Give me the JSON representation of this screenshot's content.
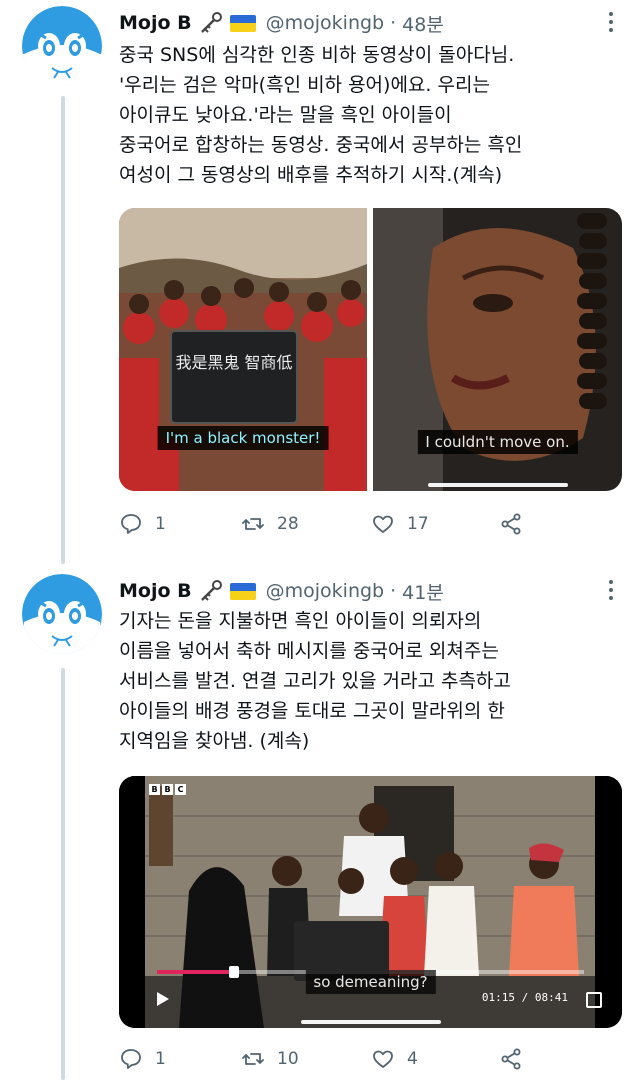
{
  "tweets": [
    {
      "name": "Mojo B",
      "handle": "@mojokingb",
      "separator": "·",
      "time": "48분",
      "lines": [
        "중국 SNS에 심각한 인종 비하 동영상이 돌아다님.",
        "'우리는 검은 악마(흑인 비하 용어)에요. 우리는",
        "아이큐도 낮아요.'라는 말을 흑인 아이들이",
        "중국어로 합창하는 동영상. 중국에서 공부하는 흑인",
        "여성이 그 동영상의 배후를 추적하기 시작.(계속)"
      ],
      "media": [
        {
          "sign_text": "我是黑鬼 智商低",
          "caption": "I'm a black monster!"
        },
        {
          "caption": "I couldn't move on."
        }
      ],
      "replies": "1",
      "retweets": "28",
      "likes": "17"
    },
    {
      "name": "Mojo B",
      "handle": "@mojokingb",
      "separator": "·",
      "time": "41분",
      "lines": [
        "기자는 돈을 지불하면 흑인 아이들이 의뢰자의",
        "이름을 넣어서 축하 메시지를 중국어로 외쳐주는",
        "서비스를 발견. 연결 고리가 있을 거라고 추측하고",
        "아이들의 배경 풍경을 토대로 그곳이 말라위의 한",
        "지역임을 찾아냄. (계속)"
      ],
      "media": [
        {
          "caption": "so demeaning?",
          "time_readout": "01:15 / 08:41",
          "progress": 0.18,
          "logo": [
            "B",
            "B",
            "C"
          ]
        }
      ],
      "replies": "1",
      "retweets": "10",
      "likes": "4"
    }
  ],
  "colors": {
    "text": "#0f1419",
    "secondary": "#536471",
    "thread_line": "#cfd9de",
    "flag_blue": "#2a6ad6",
    "flag_yellow": "#f7d117",
    "caption_cyan": "#8ff3ff",
    "video_progress": "#e0245e"
  },
  "icons": {
    "name_badges": [
      "key-icon",
      "ukraine-flag-icon"
    ],
    "actions": [
      "reply-icon",
      "retweet-icon",
      "like-icon",
      "share-icon"
    ],
    "overflow": "more-icon"
  }
}
